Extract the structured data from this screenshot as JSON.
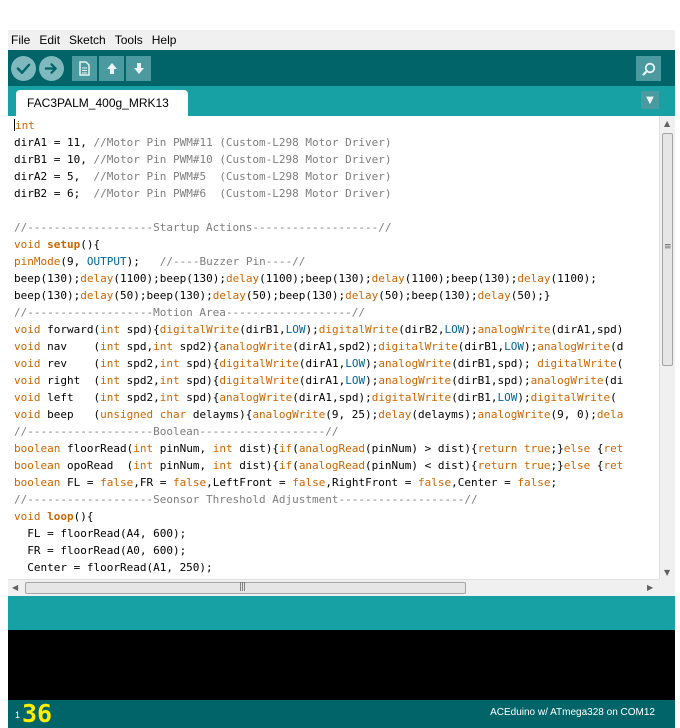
{
  "menubar": {
    "items": [
      "File",
      "Edit",
      "Sketch",
      "Tools",
      "Help"
    ]
  },
  "toolbar": {
    "buttons": [
      {
        "name": "verify",
        "icon": "check-icon"
      },
      {
        "name": "upload",
        "icon": "arrow-right-icon"
      },
      {
        "name": "new",
        "icon": "document-icon"
      },
      {
        "name": "open",
        "icon": "arrow-up-icon"
      },
      {
        "name": "save",
        "icon": "arrow-down-icon"
      },
      {
        "name": "serial-monitor",
        "icon": "magnifier-icon"
      }
    ]
  },
  "tabs": {
    "active": "FAC3PALM_400g_MRK13",
    "menu_icon": "triangle-down-icon"
  },
  "editor": {
    "code_lines": [
      [
        {
          "t": "int",
          "c": "kw"
        }
      ],
      [
        {
          "t": "dirA1 = 11, "
        },
        {
          "t": "//Motor Pin PWM#11 (Custom-L298 Motor Driver)",
          "c": "cm"
        }
      ],
      [
        {
          "t": "dirB1 = 10, "
        },
        {
          "t": "//Motor Pin PWM#10 (Custom-L298 Motor Driver)",
          "c": "cm"
        }
      ],
      [
        {
          "t": "dirA2 = 5,  "
        },
        {
          "t": "//Motor Pin PWM#5  (Custom-L298 Motor Driver)",
          "c": "cm"
        }
      ],
      [
        {
          "t": "dirB2 = 6;  "
        },
        {
          "t": "//Motor Pin PWM#6  (Custom-L298 Motor Driver)",
          "c": "cm"
        }
      ],
      [],
      [
        {
          "t": "//-------------------Startup Actions-------------------//",
          "c": "cm"
        }
      ],
      [
        {
          "t": "void ",
          "c": "kw"
        },
        {
          "t": "setup",
          "c": "kwb"
        },
        {
          "t": "(){"
        }
      ],
      [
        {
          "t": "pinMode",
          "c": "kw"
        },
        {
          "t": "(9, "
        },
        {
          "t": "OUTPUT",
          "c": "cn"
        },
        {
          "t": ");   "
        },
        {
          "t": "//----Buzzer Pin----//",
          "c": "cm"
        }
      ],
      [
        {
          "t": "beep(130);"
        },
        {
          "t": "delay",
          "c": "kw"
        },
        {
          "t": "(1100);beep(130);"
        },
        {
          "t": "delay",
          "c": "kw"
        },
        {
          "t": "(1100);beep(130);"
        },
        {
          "t": "delay",
          "c": "kw"
        },
        {
          "t": "(1100);beep(130);"
        },
        {
          "t": "delay",
          "c": "kw"
        },
        {
          "t": "(1100);"
        }
      ],
      [
        {
          "t": "beep(130);"
        },
        {
          "t": "delay",
          "c": "kw"
        },
        {
          "t": "(50);beep(130);"
        },
        {
          "t": "delay",
          "c": "kw"
        },
        {
          "t": "(50);beep(130);"
        },
        {
          "t": "delay",
          "c": "kw"
        },
        {
          "t": "(50);beep(130);"
        },
        {
          "t": "delay",
          "c": "kw"
        },
        {
          "t": "(50);}"
        }
      ],
      [
        {
          "t": "//-------------------Motion Area-------------------//",
          "c": "cm"
        }
      ],
      [
        {
          "t": "void ",
          "c": "kw"
        },
        {
          "t": "forward("
        },
        {
          "t": "int",
          "c": "kw"
        },
        {
          "t": " spd){"
        },
        {
          "t": "digitalWrite",
          "c": "kw"
        },
        {
          "t": "(dirB1,"
        },
        {
          "t": "LOW",
          "c": "cn"
        },
        {
          "t": ");"
        },
        {
          "t": "digitalWrite",
          "c": "kw"
        },
        {
          "t": "(dirB2,"
        },
        {
          "t": "LOW",
          "c": "cn"
        },
        {
          "t": ");"
        },
        {
          "t": "analogWrite",
          "c": "kw"
        },
        {
          "t": "(dirA1,spd)"
        }
      ],
      [
        {
          "t": "void ",
          "c": "kw"
        },
        {
          "t": "nav    ("
        },
        {
          "t": "int",
          "c": "kw"
        },
        {
          "t": " spd,"
        },
        {
          "t": "int",
          "c": "kw"
        },
        {
          "t": " spd2){"
        },
        {
          "t": "analogWrite",
          "c": "kw"
        },
        {
          "t": "(dirA1,spd2);"
        },
        {
          "t": "digitalWrite",
          "c": "kw"
        },
        {
          "t": "(dirB1,"
        },
        {
          "t": "LOW",
          "c": "cn"
        },
        {
          "t": ");"
        },
        {
          "t": "analogWrite",
          "c": "kw"
        },
        {
          "t": "(d"
        }
      ],
      [
        {
          "t": "void ",
          "c": "kw"
        },
        {
          "t": "rev    ("
        },
        {
          "t": "int",
          "c": "kw"
        },
        {
          "t": " spd2,"
        },
        {
          "t": "int",
          "c": "kw"
        },
        {
          "t": " spd){"
        },
        {
          "t": "digitalWrite",
          "c": "kw"
        },
        {
          "t": "(dirA1,"
        },
        {
          "t": "LOW",
          "c": "cn"
        },
        {
          "t": ");"
        },
        {
          "t": "analogWrite",
          "c": "kw"
        },
        {
          "t": "(dirB1,spd); "
        },
        {
          "t": "digitalWrite",
          "c": "kw"
        },
        {
          "t": "("
        }
      ],
      [
        {
          "t": "void ",
          "c": "kw"
        },
        {
          "t": "right  ("
        },
        {
          "t": "int",
          "c": "kw"
        },
        {
          "t": " spd2,"
        },
        {
          "t": "int",
          "c": "kw"
        },
        {
          "t": " spd){"
        },
        {
          "t": "digitalWrite",
          "c": "kw"
        },
        {
          "t": "(dirA1,"
        },
        {
          "t": "LOW",
          "c": "cn"
        },
        {
          "t": ");"
        },
        {
          "t": "analogWrite",
          "c": "kw"
        },
        {
          "t": "(dirB1,spd);"
        },
        {
          "t": "analogWrite",
          "c": "kw"
        },
        {
          "t": "(di"
        }
      ],
      [
        {
          "t": "void ",
          "c": "kw"
        },
        {
          "t": "left   ("
        },
        {
          "t": "int",
          "c": "kw"
        },
        {
          "t": " spd2,"
        },
        {
          "t": "int",
          "c": "kw"
        },
        {
          "t": " spd){"
        },
        {
          "t": "analogWrite",
          "c": "kw"
        },
        {
          "t": "(dirA1,spd);"
        },
        {
          "t": "digitalWrite",
          "c": "kw"
        },
        {
          "t": "(dirB1,"
        },
        {
          "t": "LOW",
          "c": "cn"
        },
        {
          "t": ");"
        },
        {
          "t": "digitalWrite",
          "c": "kw"
        },
        {
          "t": "("
        }
      ],
      [
        {
          "t": "void ",
          "c": "kw"
        },
        {
          "t": "beep   ("
        },
        {
          "t": "unsigned char",
          "c": "kw"
        },
        {
          "t": " delayms){"
        },
        {
          "t": "analogWrite",
          "c": "kw"
        },
        {
          "t": "(9, 25);"
        },
        {
          "t": "delay",
          "c": "kw"
        },
        {
          "t": "(delayms);"
        },
        {
          "t": "analogWrite",
          "c": "kw"
        },
        {
          "t": "(9, 0);"
        },
        {
          "t": "dela",
          "c": "kw"
        }
      ],
      [
        {
          "t": "//-------------------Boolean-------------------//",
          "c": "cm"
        }
      ],
      [
        {
          "t": "boolean",
          "c": "kw"
        },
        {
          "t": " floorRead("
        },
        {
          "t": "int",
          "c": "kw"
        },
        {
          "t": " pinNum, "
        },
        {
          "t": "int",
          "c": "kw"
        },
        {
          "t": " dist){"
        },
        {
          "t": "if",
          "c": "kw"
        },
        {
          "t": "("
        },
        {
          "t": "analogRead",
          "c": "kw"
        },
        {
          "t": "(pinNum) > dist){"
        },
        {
          "t": "return",
          "c": "kw"
        },
        {
          "t": " "
        },
        {
          "t": "true",
          "c": "kw"
        },
        {
          "t": ";}"
        },
        {
          "t": "else",
          "c": "kw"
        },
        {
          "t": " {"
        },
        {
          "t": "ret",
          "c": "kw"
        }
      ],
      [
        {
          "t": "boolean",
          "c": "kw"
        },
        {
          "t": " opoRead  ("
        },
        {
          "t": "int",
          "c": "kw"
        },
        {
          "t": " pinNum, "
        },
        {
          "t": "int",
          "c": "kw"
        },
        {
          "t": " dist){"
        },
        {
          "t": "if",
          "c": "kw"
        },
        {
          "t": "("
        },
        {
          "t": "analogRead",
          "c": "kw"
        },
        {
          "t": "(pinNum) < dist){"
        },
        {
          "t": "return",
          "c": "kw"
        },
        {
          "t": " "
        },
        {
          "t": "true",
          "c": "kw"
        },
        {
          "t": ";}"
        },
        {
          "t": "else",
          "c": "kw"
        },
        {
          "t": " {"
        },
        {
          "t": "ret",
          "c": "kw"
        }
      ],
      [
        {
          "t": "boolean",
          "c": "kw"
        },
        {
          "t": " FL = "
        },
        {
          "t": "false",
          "c": "kw"
        },
        {
          "t": ",FR = "
        },
        {
          "t": "false",
          "c": "kw"
        },
        {
          "t": ",LeftFront = "
        },
        {
          "t": "false",
          "c": "kw"
        },
        {
          "t": ",RightFront = "
        },
        {
          "t": "false",
          "c": "kw"
        },
        {
          "t": ",Center = "
        },
        {
          "t": "false",
          "c": "kw"
        },
        {
          "t": ";"
        }
      ],
      [
        {
          "t": "//-------------------Seonsor Threshold Adjustment-------------------//",
          "c": "cm"
        }
      ],
      [
        {
          "t": "void ",
          "c": "kw"
        },
        {
          "t": "loop",
          "c": "kwb"
        },
        {
          "t": "(){"
        }
      ],
      [
        {
          "t": "  FL = floorRead(A4, 600);"
        }
      ],
      [
        {
          "t": "  FR = floorRead(A0, 600);"
        }
      ],
      [
        {
          "t": "  Center = floorRead(A1, 250);"
        }
      ]
    ]
  },
  "scroll": {
    "hgrip": "|||",
    "vgrip": "≡"
  },
  "status": {
    "line_number": "1",
    "big_number": "36",
    "board": "ACEduino w/ ATmega328 on COM12"
  },
  "colors": {
    "frame": "#17a1a5",
    "toolbar": "#006468",
    "keyword": "#cc6600",
    "constant": "#006699",
    "comment": "#7e7e7e",
    "console": "#000000",
    "big_number": "#ffee00"
  }
}
